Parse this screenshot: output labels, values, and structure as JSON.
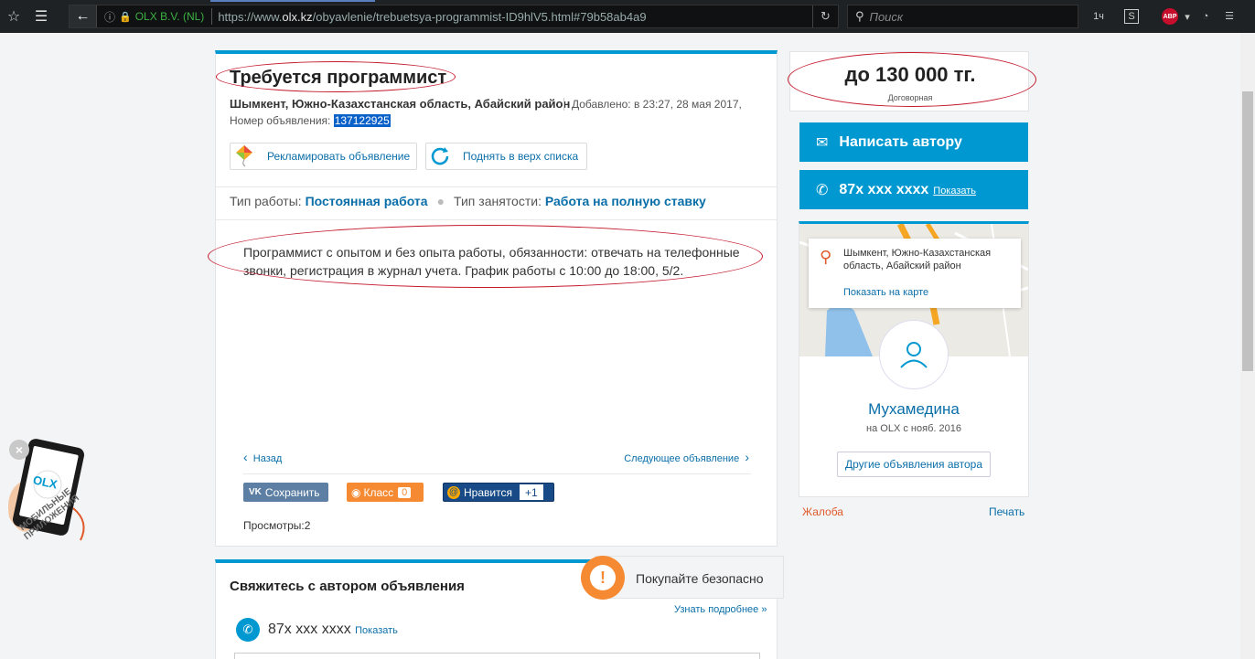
{
  "browser": {
    "site_owner": "OLX B.V. (NL)",
    "url_prefix": "https://www.",
    "url_domain": "olx.kz",
    "url_path": "/obyavlenie/trebuetsya-programmist-ID9hlV5.html#79b58ab4a9",
    "search_placeholder": "Поиск",
    "abp_label": "ABP",
    "ext_label": "1ч"
  },
  "ad": {
    "title": "Требуется программист",
    "location": "Шымкент, Южно-Казахстанская область, Абайский район",
    "added": "Добавлено: в 23:27, 28 мая 2017,",
    "number_label": "Номер объявления: ",
    "number": "137122925",
    "promote_label": "Рекламировать объявление",
    "raise_label": "Поднять в верх списка",
    "job_type_label": "Тип работы: ",
    "job_type": "Постоянная работа",
    "employment_label": "Тип занятости: ",
    "employment": "Работа на полную ставку",
    "description": "Программист с опытом и без опыта работы, обязанности: отвечать на телефонные звонки, регистрация в журнал учета. График работы с 10:00 до 18:00, 5/2.",
    "prev_label": "Назад",
    "next_label": "Следующее объявление",
    "share_vk": "Сохранить",
    "share_ok": "Класс",
    "share_ok_count": "0",
    "share_mr": "Нравится",
    "share_mr_count": "+1",
    "views_label": "Просмотры:",
    "views_count": "2"
  },
  "contact": {
    "title": "Свяжитесь с автором объявления",
    "learn_more": "Узнать подробнее »",
    "phone": "87x xxx xxxx",
    "show_label": "Показать"
  },
  "safe_buy": {
    "label": "Покупайте безопасно"
  },
  "sidebar": {
    "price": "до 130 000 тг.",
    "price_note": "Договорная",
    "write_label": "Написать автору",
    "phone": "87x xxx xxxx",
    "show_label": "Показать",
    "address": "Шымкент, Южно-Казахстанская область, Абайский район",
    "map_link": "Показать на карте",
    "seller_name": "Мухамедина",
    "seller_since": "на OLX с нояб. 2016",
    "other_ads": "Другие объявления автора",
    "complaint": "Жалоба",
    "print": "Печать"
  },
  "promo": {
    "label": "МОБИЛЬНЫЕ ПРИЛОЖЕНИЯ",
    "logo": "OLX"
  },
  "colors": {
    "accent": "#0098d0",
    "link": "#0a6ea8",
    "annotation": "#c41a2d",
    "warning": "#f58a32"
  }
}
